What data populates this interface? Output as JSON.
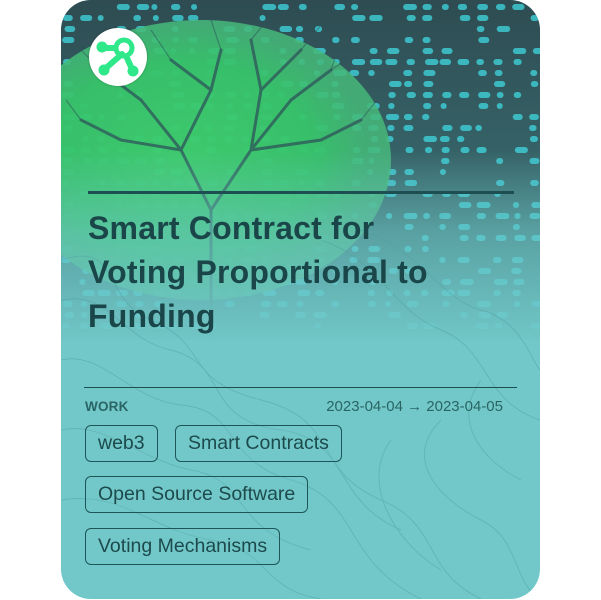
{
  "card": {
    "logo_icon": "network-nodes-logo-icon",
    "hero_image": "tree-with-digital-code-background",
    "title": "Smart Contract for Voting Proportional to Funding",
    "title_lines": [
      "Smart Contract for",
      "Voting Proportional to",
      "Funding"
    ],
    "category": "WORK",
    "dates": "2023-04-04 → 2023-04-05",
    "tags": [
      "web3",
      "Smart Contracts",
      "Open Source Software",
      "Voting Mechanisms"
    ]
  },
  "colors": {
    "background": "#72c8c8",
    "text_dark": "#1a4549",
    "accent_green": "#2ee88a"
  }
}
